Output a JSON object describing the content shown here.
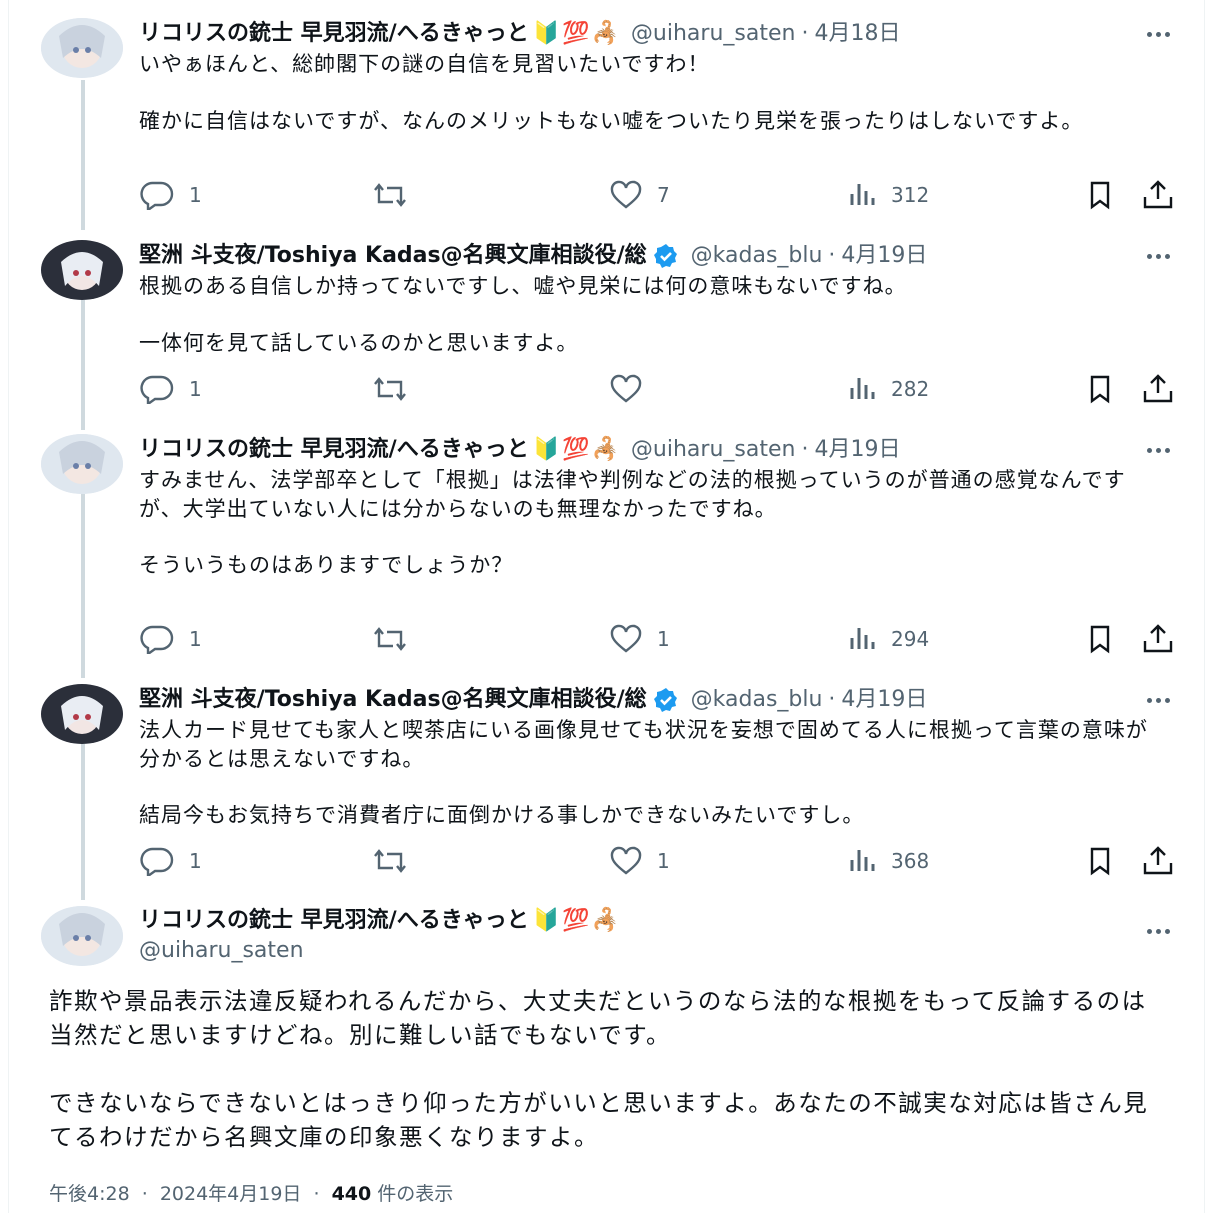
{
  "thread": [
    {
      "name": "リコリスの銃士 早見羽流/へるきゃっと",
      "badges": [
        "🔰",
        "💯",
        "🦂"
      ],
      "handle": "@uiharu_saten",
      "date": "4月18日",
      "paragraphs": [
        "いやぁほんと、総帥閣下の謎の自信を見習いたいですわ！",
        "確かに自信はないですが、なんのメリットもない嘘をついたり見栄を張ったりはしないですよ。"
      ],
      "replies": "1",
      "retweets": "",
      "likes": "7",
      "views": "312",
      "verified": false
    },
    {
      "name": "堅洲 斗支夜/Toshiya Kadas@名興文庫相談役/総",
      "badges": [],
      "handle": "@kadas_blu",
      "date": "4月19日",
      "paragraphs": [
        "根拠のある自信しか持ってないですし、嘘や見栄には何の意味もないですね。",
        "一体何を見て話しているのかと思いますよ。"
      ],
      "replies": "1",
      "retweets": "",
      "likes": "",
      "views": "282",
      "verified": true
    },
    {
      "name": "リコリスの銃士 早見羽流/へるきゃっと",
      "badges": [
        "🔰",
        "💯",
        "🦂"
      ],
      "handle": "@uiharu_saten",
      "date": "4月19日",
      "paragraphs": [
        "すみません、法学部卒として「根拠」は法律や判例などの法的根拠っていうのが普通の感覚なんですが、大学出ていない人には分からないのも無理なかったですね。",
        "そういうものはありますでしょうか？"
      ],
      "replies": "1",
      "retweets": "",
      "likes": "1",
      "views": "294",
      "verified": false
    },
    {
      "name": "堅洲 斗支夜/Toshiya Kadas@名興文庫相談役/総",
      "badges": [],
      "handle": "@kadas_blu",
      "date": "4月19日",
      "paragraphs": [
        "法人カード見せても家人と喫茶店にいる画像見せても状況を妄想で固めてる人に根拠って言葉の意味が分かるとは思えないですね。",
        "結局今もお気持ちで消費者庁に面倒かける事しかできないみたいですし。"
      ],
      "replies": "1",
      "retweets": "",
      "likes": "1",
      "views": "368",
      "verified": true
    }
  ],
  "main": {
    "name": "リコリスの銃士 早見羽流/へるきゃっと",
    "badges": [
      "🔰",
      "💯",
      "🦂"
    ],
    "handle": "@uiharu_saten",
    "paragraphs": [
      "詐欺や景品表示法違反疑われるんだから、大丈夫だというのなら法的な根拠をもって反論するのは当然だと思いますけどね。別に難しい話でもないです。",
      "できないならできないとはっきり仰った方がいいと思いますよ。あなたの不誠実な対応は皆さん見てるわけだから名興文庫の印象悪くなりますよ。"
    ],
    "time": "午後4:28",
    "date": "2024年4月19日",
    "views_count": "440",
    "views_label": "件の表示",
    "sep": "·"
  },
  "colors": {
    "text": "#0f1419",
    "secondary": "#536471",
    "verified": "#1d9bf0",
    "thread_line": "#cfd9de"
  },
  "icons": [
    "reply-icon",
    "retweet-icon",
    "like-icon",
    "views-icon",
    "bookmark-icon",
    "share-icon",
    "more-icon",
    "verified-badge-icon"
  ]
}
